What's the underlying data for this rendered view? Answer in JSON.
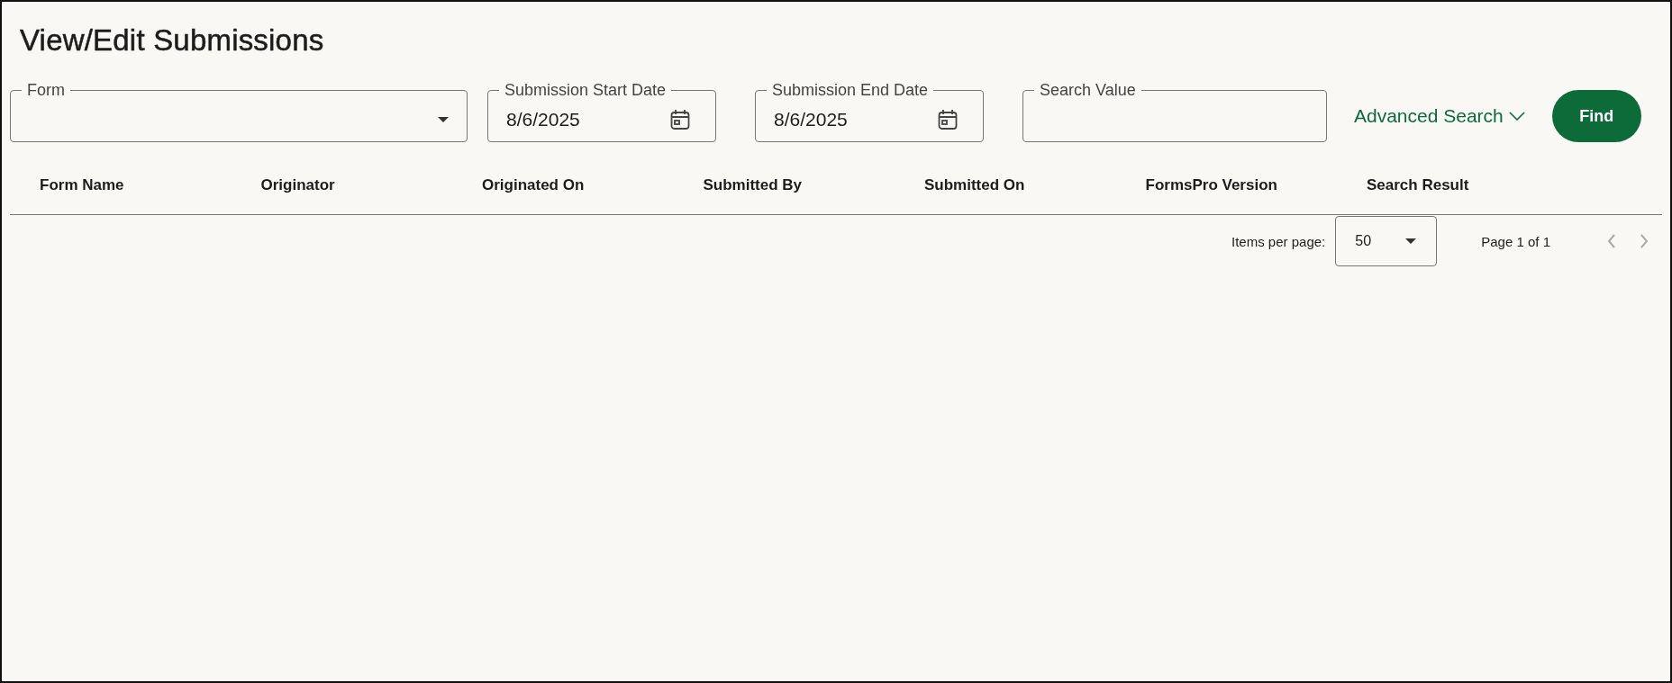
{
  "page": {
    "title": "View/Edit Submissions"
  },
  "filters": [
    {
      "kind": "select",
      "label": "Form"
    },
    {
      "kind": "date",
      "label": "Submission Start Date",
      "value": "8/6/2025"
    },
    {
      "kind": "date",
      "label": "Submission End Date",
      "value": "8/6/2025"
    },
    {
      "kind": "text",
      "label": "Search Value"
    }
  ],
  "advanced_search": {
    "label": "Advanced Search",
    "expanded": false
  },
  "find_button": {
    "label": "Find"
  },
  "table": {
    "columns": [
      "Form Name",
      "Originator",
      "Originated On",
      "Submitted By",
      "Submitted On",
      "FormsPro Version",
      "Search Result"
    ]
  },
  "paginator": {
    "items_per_page_label": "Items per page:",
    "page_size": "50",
    "range": "Page 1 of 1",
    "previous_disabled": true,
    "next_disabled": true
  }
}
